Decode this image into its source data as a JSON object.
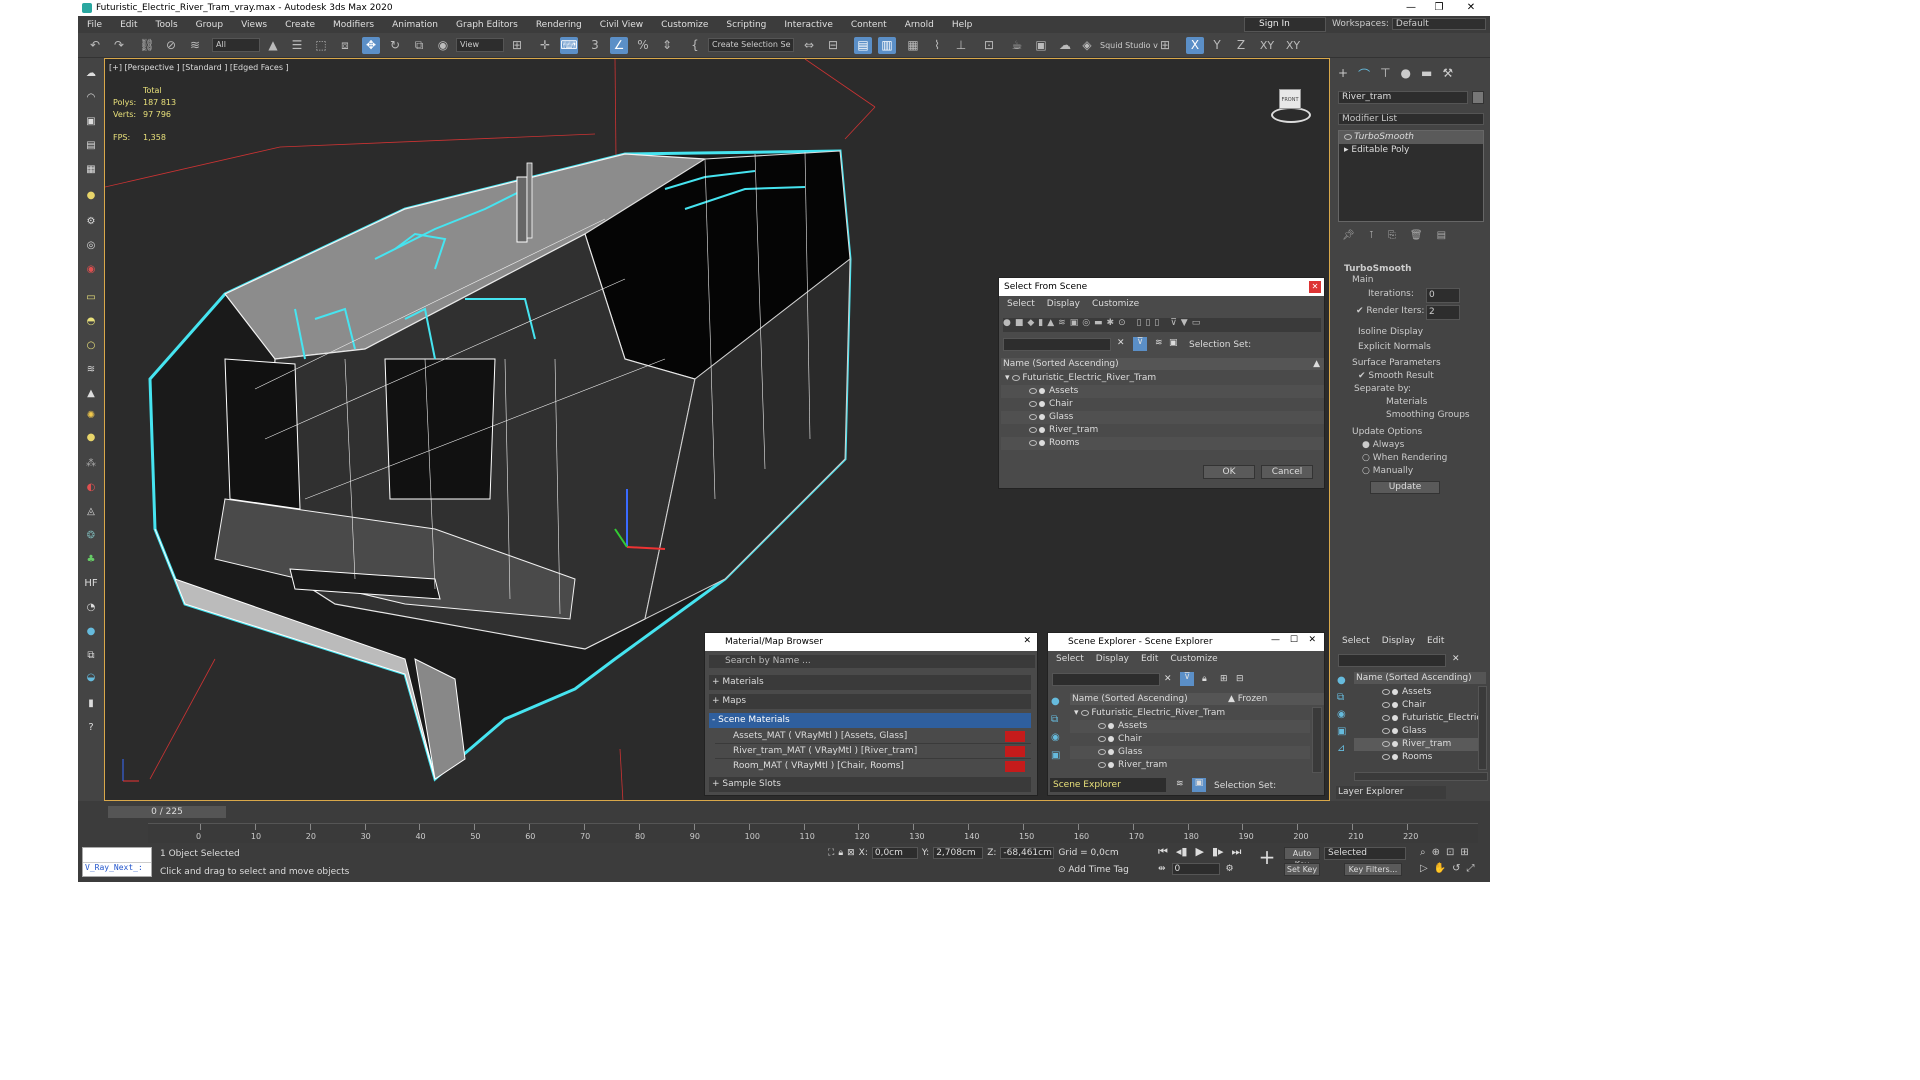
{
  "window": {
    "title": "Futuristic_Electric_River_Tram_vray.max - Autodesk 3ds Max 2020"
  },
  "menu": [
    "File",
    "Edit",
    "Tools",
    "Group",
    "Views",
    "Create",
    "Modifiers",
    "Animation",
    "Graph Editors",
    "Rendering",
    "Civil View",
    "Customize",
    "Scripting",
    "Interactive",
    "Content",
    "Arnold",
    "Help"
  ],
  "signin": "Sign In",
  "workspace": {
    "label": "Workspaces:",
    "value": "Default"
  },
  "toolbar": {
    "filter": "All",
    "refcoord": "View",
    "selset": "Create Selection Se",
    "squid": "Squid Studio v",
    "axes": [
      "X",
      "Y",
      "Z",
      "XY",
      "XY"
    ]
  },
  "viewport": {
    "label": "[+] [Perspective ] [Standard ] [Edged Faces ]",
    "stats": {
      "total": "Total",
      "polys_label": "Polys:",
      "polys": "187 813",
      "verts_label": "Verts:",
      "verts": "97 796",
      "fps_label": "FPS:",
      "fps": "1,358"
    },
    "viewcube": "FRONT"
  },
  "modify": {
    "object_name": "River_tram",
    "modifier_list": "Modifier List",
    "stack": [
      "TurboSmooth",
      "Editable Poly"
    ]
  },
  "turbosmooth": {
    "title": "TurboSmooth",
    "main": "Main",
    "iterations_label": "Iterations:",
    "iterations": "0",
    "render_iters_label": "Render Iters:",
    "render_iters": "2",
    "isoline": "Isoline Display",
    "explicit": "Explicit Normals",
    "surface": "Surface Parameters",
    "smooth_result": "Smooth Result",
    "separate": "Separate by:",
    "materials": "Materials",
    "smoothing": "Smoothing Groups",
    "update_opts": "Update Options",
    "always": "Always",
    "when_rendering": "When Rendering",
    "manually": "Manually",
    "update": "Update"
  },
  "select_from_scene": {
    "title": "Select From Scene",
    "menu": [
      "Select",
      "Display",
      "Customize"
    ],
    "selection_set": "Selection Set:",
    "col_header": "Name (Sorted Ascending)",
    "root": "Futuristic_Electric_River_Tram",
    "items": [
      "Assets",
      "Chair",
      "Glass",
      "River_tram",
      "Rooms"
    ],
    "ok": "OK",
    "cancel": "Cancel"
  },
  "material_browser": {
    "title": "Material/Map Browser",
    "search": "Search by Name ...",
    "sections": [
      "+ Materials",
      "+ Maps",
      "- Scene Materials"
    ],
    "materials": [
      "Assets_MAT ( VRayMtl ) [Assets, Glass]",
      "River_tram_MAT ( VRayMtl ) [River_tram]",
      "Room_MAT ( VRayMtl ) [Chair, Rooms]"
    ],
    "sample_slots": "+ Sample Slots"
  },
  "scene_explorer": {
    "title": "Scene Explorer - Scene Explorer",
    "menu": [
      "Select",
      "Display",
      "Edit",
      "Customize"
    ],
    "col_name": "Name (Sorted Ascending)",
    "col_frozen": "▲ Frozen",
    "root": "Futuristic_Electric_River_Tram",
    "items": [
      "Assets",
      "Chair",
      "Glass",
      "River_tram"
    ],
    "footer_name": "Scene Explorer",
    "footer_set": "Selection Set:"
  },
  "layer_explorer": {
    "menu": [
      "Select",
      "Display",
      "Edit"
    ],
    "col": "Name (Sorted Ascending)",
    "items": [
      "Assets",
      "Chair",
      "Futuristic_Electric_R",
      "Glass",
      "River_tram",
      "Rooms"
    ],
    "footer": "Layer Explorer"
  },
  "timeline": {
    "frame": "0 / 225",
    "ticks": [
      "0",
      "10",
      "20",
      "30",
      "40",
      "50",
      "60",
      "70",
      "80",
      "90",
      "100",
      "110",
      "120",
      "130",
      "140",
      "150",
      "160",
      "170",
      "180",
      "190",
      "200",
      "210",
      "220"
    ]
  },
  "status": {
    "maxscript": "V_Ray_Next_:",
    "selected": "1 Object Selected",
    "hint": "Click and drag to select and move objects",
    "x_label": "X:",
    "x": "0,0cm",
    "y_label": "Y:",
    "y": "2,708cm",
    "z_label": "Z:",
    "z": "-68,461cm",
    "grid": "Grid = 0,0cm",
    "add_time_tag": "Add Time Tag",
    "auto_key": "Auto Key",
    "set_key": "Set Key",
    "selected_dd": "Selected",
    "key_filters": "Key Filters...",
    "frame_field": "0"
  }
}
